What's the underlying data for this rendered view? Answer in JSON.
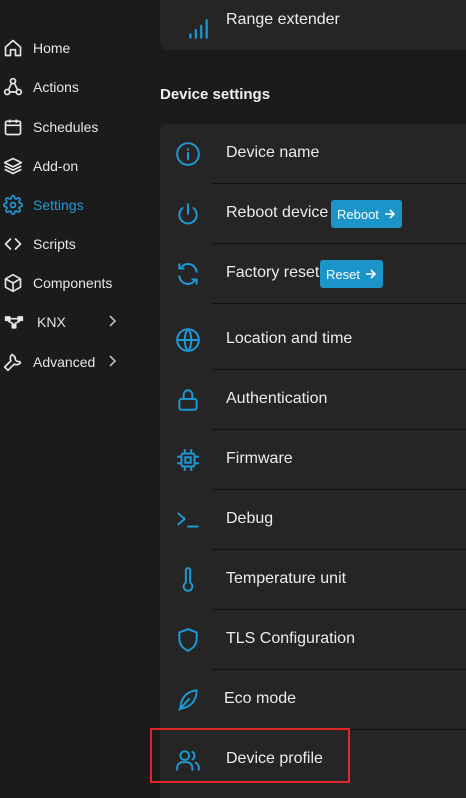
{
  "sidebar": {
    "items": [
      {
        "label": "Home",
        "icon": "home-icon"
      },
      {
        "label": "Actions",
        "icon": "actions-icon"
      },
      {
        "label": "Schedules",
        "icon": "calendar-icon"
      },
      {
        "label": "Add-on",
        "icon": "layers-icon"
      },
      {
        "label": "Settings",
        "icon": "gear-icon",
        "active": true
      },
      {
        "label": "Scripts",
        "icon": "code-icon"
      },
      {
        "label": "Components",
        "icon": "components-icon"
      },
      {
        "label": "KNX",
        "icon": "knx-network-icon",
        "has_submenu": true
      },
      {
        "label": "Advanced",
        "icon": "wrench-icon",
        "has_submenu": true
      }
    ]
  },
  "main": {
    "top_item": {
      "label": "Range extender",
      "icon": "signal-bars-icon"
    },
    "section_title": "Device settings",
    "settings": [
      {
        "label": "Device name",
        "icon": "info-icon"
      },
      {
        "label": "Reboot device",
        "icon": "power-icon",
        "button": "Reboot"
      },
      {
        "label": "Factory reset",
        "icon": "refresh-icon",
        "button": "Reset"
      },
      {
        "label": "Location and time",
        "icon": "globe-icon"
      },
      {
        "label": "Authentication",
        "icon": "lock-icon"
      },
      {
        "label": "Firmware",
        "icon": "chip-icon"
      },
      {
        "label": "Debug",
        "icon": "terminal-icon"
      },
      {
        "label": "Temperature unit",
        "icon": "thermometer-icon"
      },
      {
        "label": "TLS Configuration",
        "icon": "shield-icon"
      },
      {
        "label": "Eco mode",
        "icon": "leaf-icon"
      },
      {
        "label": "Device profile",
        "icon": "users-icon",
        "highlighted": true
      }
    ]
  },
  "colors": {
    "accent": "#1e9ad6",
    "button": "#1a94c9",
    "highlight": "#e0262b",
    "background": "#1b1b1b",
    "card": "#252525"
  }
}
